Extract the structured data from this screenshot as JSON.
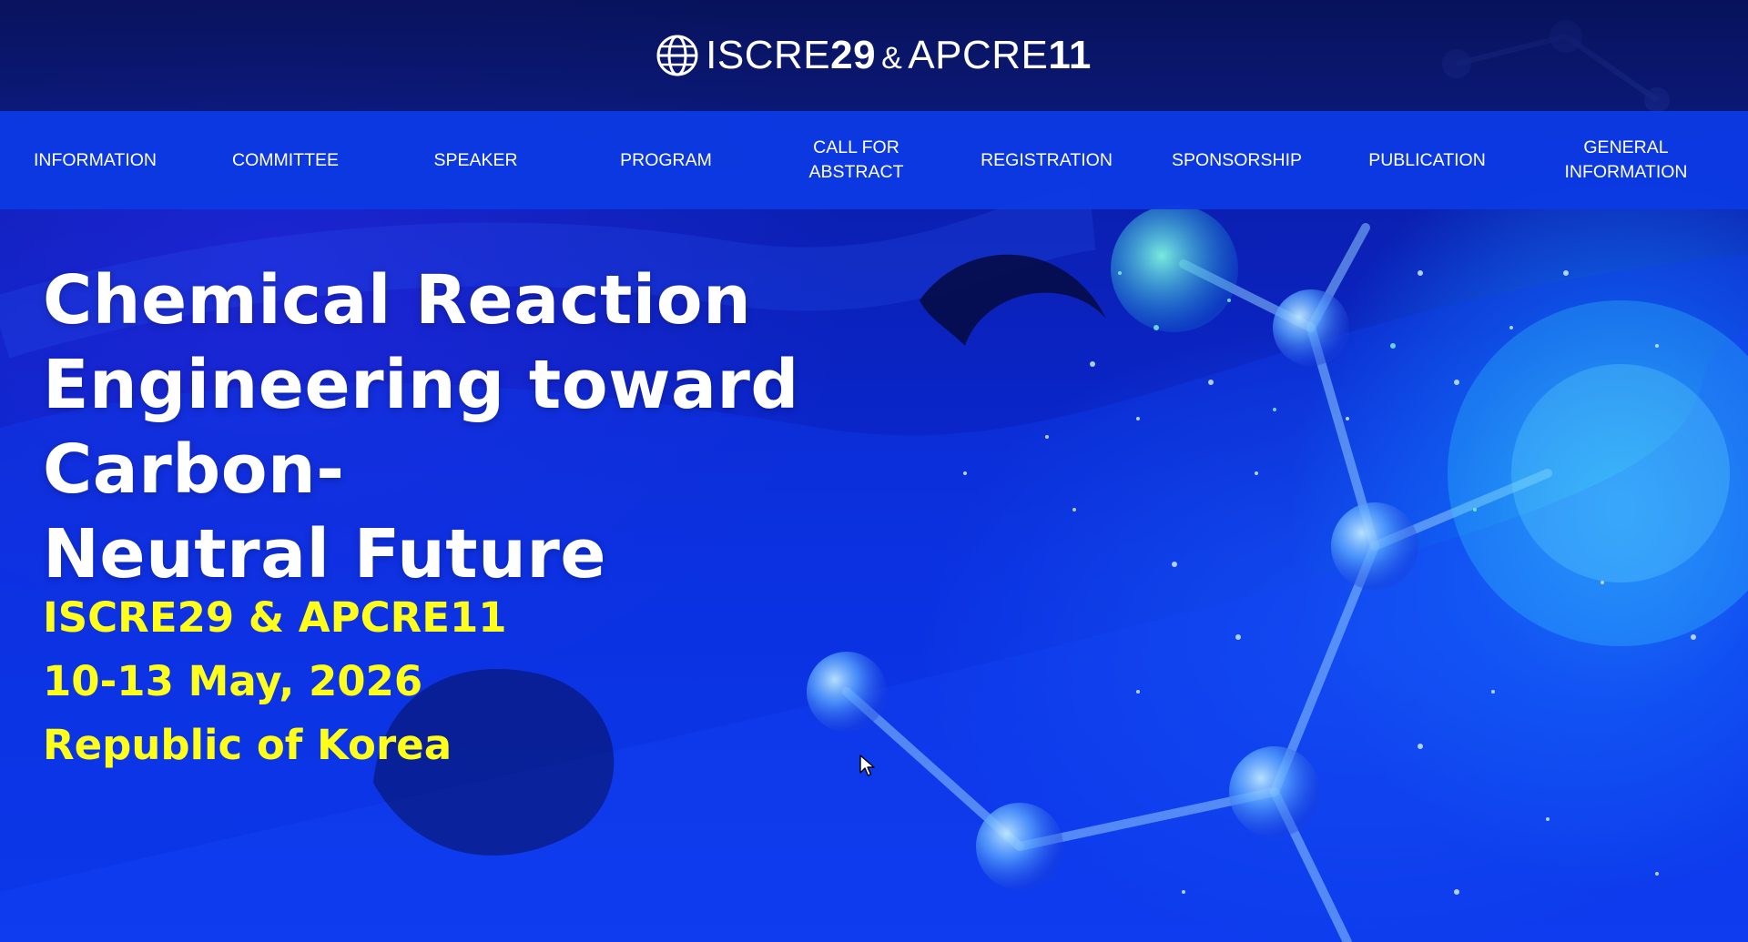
{
  "header": {
    "logo": {
      "icon": "globe-icon",
      "part1": "ISCRE",
      "num1": "29",
      "amp": "&",
      "part2": "APCRE",
      "num2": "11"
    }
  },
  "nav": {
    "items": [
      {
        "label": "INFORMATION"
      },
      {
        "label": "COMMITTEE"
      },
      {
        "label": "SPEAKER"
      },
      {
        "label": "PROGRAM"
      },
      {
        "label": "CALL FOR ABSTRACT"
      },
      {
        "label": "REGISTRATION"
      },
      {
        "label": "SPONSORSHIP"
      },
      {
        "label": "PUBLICATION"
      },
      {
        "label": "GENERAL INFORMATION"
      }
    ]
  },
  "hero": {
    "headline_lines": [
      "Chemical Reaction",
      "Engineering toward Carbon-",
      "Neutral Future"
    ],
    "event_name": "ISCRE29 & APCRE11",
    "event_dates": "10-13 May, 2026",
    "event_location": "Republic of Korea"
  },
  "colors": {
    "nav_bg": "#0c3ae4",
    "topbar_bg": "#08125a",
    "headline": "#ffffff",
    "event_text": "#ffff1a"
  },
  "icons": {
    "cursor": "mouse-pointer-icon"
  }
}
